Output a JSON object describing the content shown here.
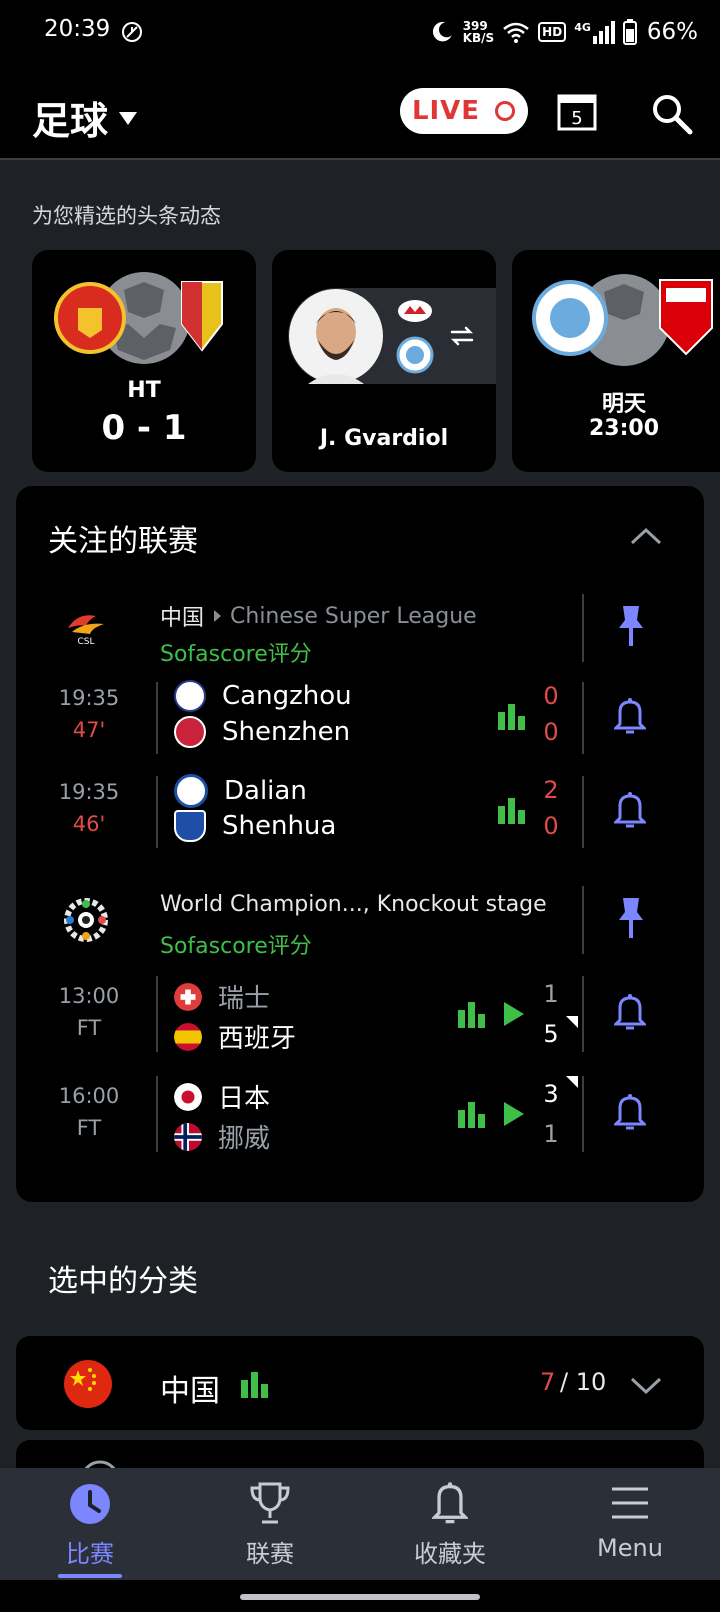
{
  "status_bar": {
    "time": "20:39",
    "net_speed_top": "399",
    "net_speed_bottom": "KB/S",
    "hd": "HD",
    "signal_type": "4G",
    "battery": "66%"
  },
  "header": {
    "title": "足球",
    "live_label": "LIVE",
    "calendar_day": "5"
  },
  "highlights": {
    "label": "为您精选的头条动态",
    "cards": [
      {
        "status": "HT",
        "score": "0 - 1"
      },
      {
        "player": "J. Gvardiol"
      },
      {
        "date": "明天",
        "time": "23:00"
      }
    ]
  },
  "followed": {
    "title": "关注的联赛",
    "leagues": [
      {
        "country": "中国",
        "name": "Chinese Super League",
        "rating": "Sofascore评分",
        "matches": [
          {
            "time": "19:35",
            "minute": "47'",
            "home": "Cangzhou",
            "away": "Shenzhen",
            "home_score": "0",
            "away_score": "0"
          },
          {
            "time": "19:35",
            "minute": "46'",
            "home": "Dalian",
            "away": "Shenhua",
            "home_score": "2",
            "away_score": "0"
          }
        ]
      },
      {
        "name": "World Champion..., Knockout stage",
        "rating": "Sofascore评分",
        "matches": [
          {
            "time": "13:00",
            "status": "FT",
            "home": "瑞士",
            "away": "西班牙",
            "home_score": "1",
            "away_score": "5"
          },
          {
            "time": "16:00",
            "status": "FT",
            "home": "日本",
            "away": "挪威",
            "home_score": "3",
            "away_score": "1"
          }
        ]
      }
    ]
  },
  "categories": {
    "title": "选中的分类",
    "items": [
      {
        "name": "中国",
        "live": "7",
        "total": "/ 10"
      }
    ]
  },
  "nav": {
    "items": [
      {
        "label": "比赛"
      },
      {
        "label": "联赛"
      },
      {
        "label": "收藏夹"
      },
      {
        "label": "Menu"
      }
    ]
  },
  "colors": {
    "accent": "#7b86ff",
    "live": "#e04b4b",
    "green": "#3fbf4a",
    "bg": "#1e2227"
  }
}
